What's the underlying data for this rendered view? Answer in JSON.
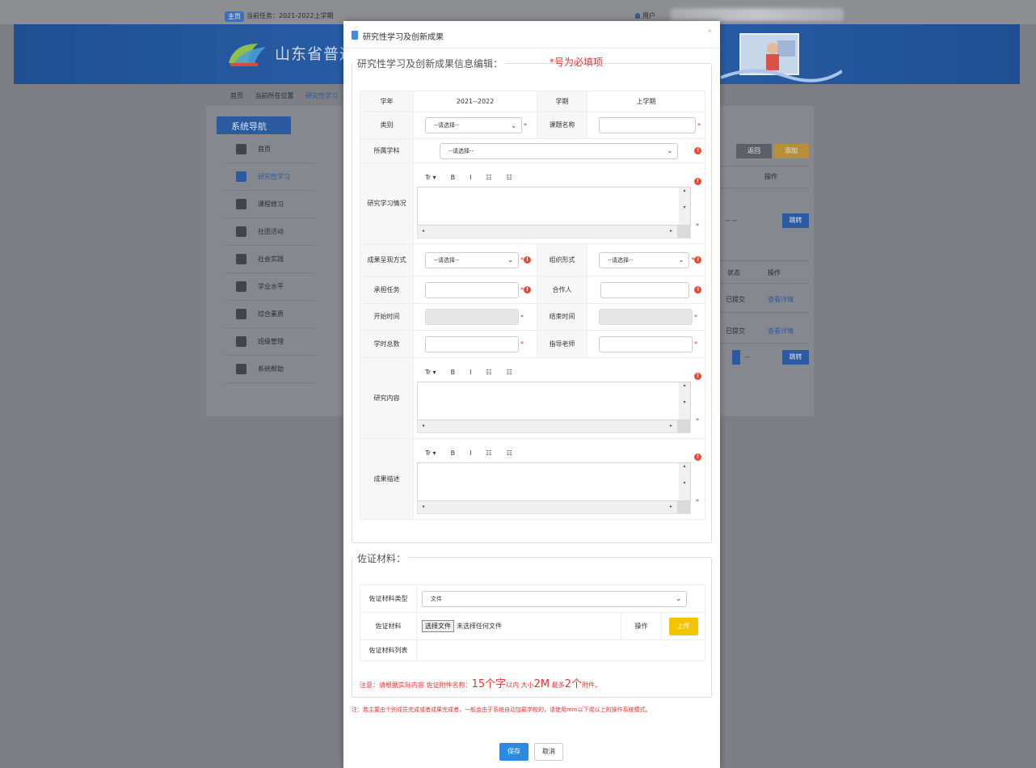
{
  "topbar": {
    "tag": "主页",
    "task": "当前任务：2021-2022上学期",
    "user": "用户"
  },
  "banner": {
    "site_title": "山东省普通"
  },
  "breadcrumb": [
    "首页",
    "当前所在位置",
    "研究性学习"
  ],
  "nav": {
    "header": "系统导航",
    "items": [
      "首页",
      "研究性学习",
      "课程修习",
      "社团活动",
      "社会实践",
      "学业水平",
      "综合素质",
      "班级管理",
      "系统帮助"
    ]
  },
  "background": {
    "back_button": "返回",
    "add_button": "添加",
    "op_header": "操作",
    "status_header": "状态",
    "go_button": "跳转",
    "row_status": "已提交",
    "row_link": "查看详情"
  },
  "modal": {
    "title": "研究性学习及创新成果",
    "close": "×",
    "section1_legend": "研究性学习及创新成果信息编辑：",
    "required_note": "*号为必填项",
    "fields": {
      "school_year_label": "学年",
      "school_year_value": "2021--2022",
      "semester_label": "学期",
      "semester_value": "上学期",
      "category_label": "类别",
      "category_placeholder": "--请选择--",
      "topic_name_label": "课题名称",
      "subject_label": "所属学科",
      "subject_placeholder": "--请选择--",
      "research_intro_label": "研究学习情况",
      "result_form_label": "成果呈现方式",
      "result_form_placeholder": "--请选择--",
      "org_form_label": "组织形式",
      "org_form_placeholder": "--请选择--",
      "role_label": "承担任务",
      "partner_label": "合作人",
      "start_time_label": "开始时间",
      "end_time_label": "结束时间",
      "hours_label": "学时总数",
      "teacher_label": "指导老师",
      "content_label": "研究内容",
      "summary_label": "成果描述"
    },
    "editor_toolbar": [
      "Tr ▾",
      "B",
      "I",
      "☷",
      "☷"
    ],
    "section2_legend": "佐证材料：",
    "evidence": {
      "type_label": "佐证材料类型",
      "type_value": "文件",
      "file_label": "佐证材料",
      "choose_button": "选择文件",
      "no_file": "未选择任何文件",
      "op_label": "操作",
      "upload_button": "上传",
      "list_label": "佐证材料列表"
    },
    "note1": {
      "prefix": "注意：请根据实际内容  佐证附件名称：",
      "count1": "15个字",
      "mid1": "以内  大小",
      "size": "2M",
      "mid2": "  最多",
      "count2": "2个",
      "suffix": "附件。"
    },
    "note2": "注：若主要由个别成员完成或者成果完成者，一般会由于系统自动加载学校的，请使用mm以下或以上的操作系统模式。",
    "save_button": "保存",
    "cancel_button": "取消"
  }
}
